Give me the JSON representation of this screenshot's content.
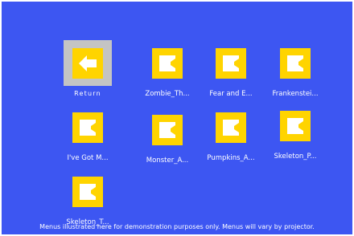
{
  "menu": {
    "items": [
      {
        "label": "Return",
        "icon": "return-arrow-icon",
        "selected": true
      },
      {
        "label": "Zombie_Th...",
        "icon": "video-file-icon"
      },
      {
        "label": "Fear and E...",
        "icon": "video-file-icon"
      },
      {
        "label": "Frankenstei...",
        "icon": "video-file-icon"
      },
      {
        "label": "I've Got M...",
        "icon": "video-file-icon"
      },
      {
        "label": "Monster_A...",
        "icon": "video-file-icon"
      },
      {
        "label": "Pumpkins_A...",
        "icon": "video-file-icon"
      },
      {
        "label": "Skeleton_P...",
        "icon": "video-file-icon"
      },
      {
        "label": "Skeleton_T...",
        "icon": "video-file-icon"
      }
    ]
  },
  "footer": {
    "disclaimer": "Menus illustrated here for demonstration purposes only. Menus will vary by projector."
  },
  "colors": {
    "background": "#3d56f2",
    "icon_fill": "#ffd400",
    "selection": "#c4c4c4"
  }
}
